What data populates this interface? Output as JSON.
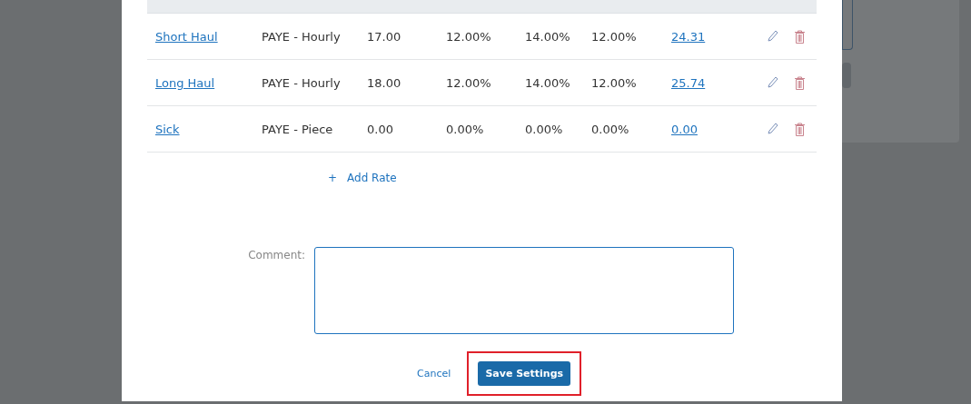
{
  "rates": [
    {
      "name": "Short Haul",
      "rate_type": "PAYE - Hourly",
      "column_3": "17.00",
      "column_4": "12.00%",
      "column_5": "14.00%",
      "column_6": "12.00%",
      "column_7": "24.31"
    },
    {
      "name": "Long Haul",
      "rate_type": "PAYE - Hourly",
      "column_3": "18.00",
      "column_4": "12.00%",
      "column_5": "14.00%",
      "column_6": "12.00%",
      "column_7": "25.74"
    },
    {
      "name": "Sick",
      "rate_type": "PAYE - Piece",
      "column_3": "0.00",
      "column_4": "0.00%",
      "column_5": "0.00%",
      "column_6": "0.00%",
      "column_7": "0.00"
    }
  ],
  "add_rate": {
    "icon": "+",
    "label": "Add Rate"
  },
  "comment": {
    "label": "Comment:"
  },
  "buttons": {
    "cancel": "Cancel",
    "save": "Save Settings",
    "save_highlighted": true
  }
}
